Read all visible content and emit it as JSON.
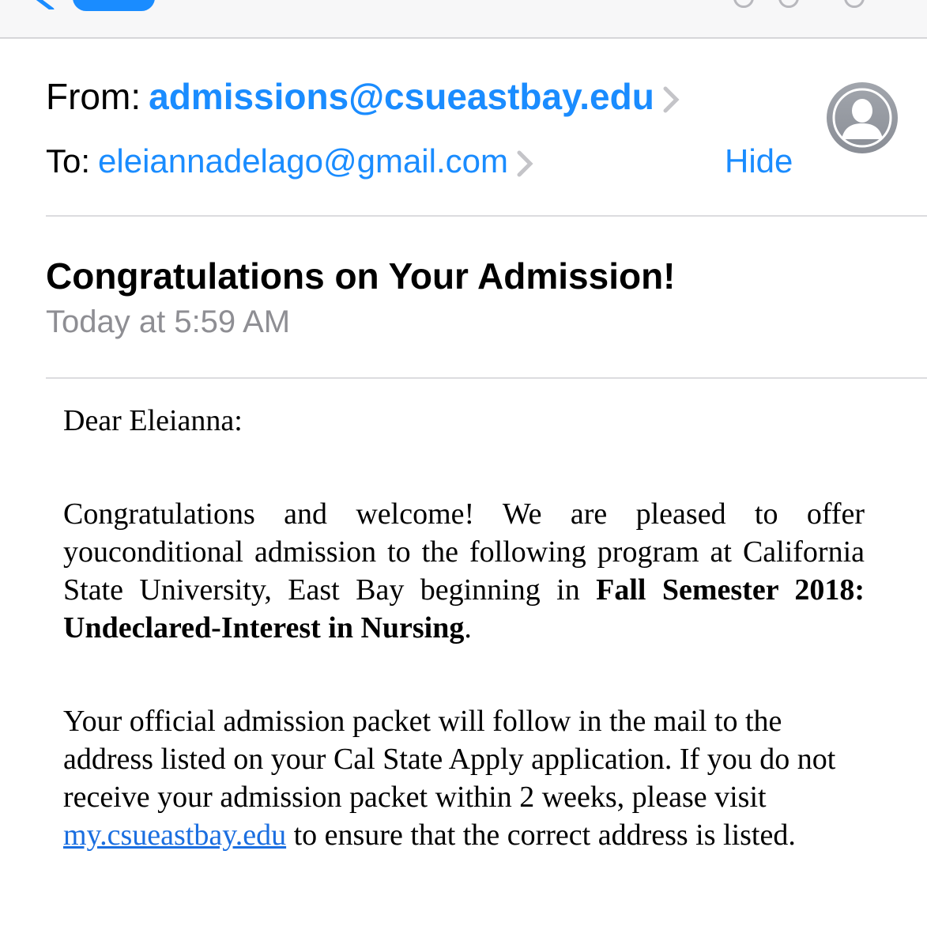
{
  "header": {
    "from_label": "From:",
    "from_address": "admissions@csueastbay.edu",
    "to_label": "To:",
    "to_address": "eleiannadelago@gmail.com",
    "hide_label": "Hide"
  },
  "message": {
    "subject": "Congratulations on Your Admission!",
    "date": "Today at 5:59 AM",
    "greeting": "Dear Eleianna:",
    "para1_start": "Congratulations and welcome! We are pleased to offer youconditional admission to the following program at California State University, East Bay beginning in ",
    "para1_bold": "Fall Semester 2018: Undeclared-Interest in Nursing",
    "para1_end": ".",
    "para2_start": "Your official admission packet will follow in the mail to the address listed on your Cal State Apply application. If you do not receive your admission packet within 2 weeks, please visit ",
    "para2_link": "my.csueastbay.edu",
    "para2_end": " to ensure that the correct address is listed."
  },
  "colors": {
    "accent": "#1a8cff",
    "secondary_text": "#8e8e93",
    "divider": "#dcdcdf",
    "link": "#1a6ee0"
  },
  "icons": {
    "back": "chevron-left-icon",
    "disclosure": "chevron-right-icon",
    "avatar": "person-silhouette-icon"
  }
}
